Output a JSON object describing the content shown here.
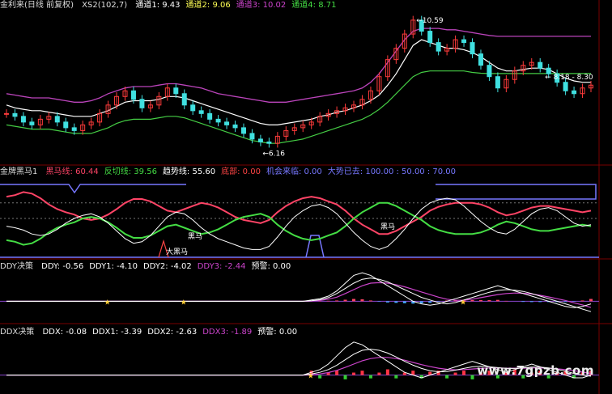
{
  "panels": {
    "main": {
      "title": "金利来(日线 前复权)",
      "params": "XS2(102,7)",
      "legend": [
        {
          "label": "通道1: 9.43",
          "color": "#ffffff"
        },
        {
          "label": "通道2: 9.06",
          "color": "#ffff55"
        },
        {
          "label": "通道3: 10.02",
          "color": "#cc44cc"
        },
        {
          "label": "通道4: 8.71",
          "color": "#44dd44"
        }
      ],
      "annotations": {
        "high": "10.59",
        "low": "6.16",
        "last": "8.18 - 8.30"
      }
    },
    "horse": {
      "title": "金牌黑马1",
      "legend": [
        {
          "label": "黑马线: 60.44",
          "color": "#ff4466"
        },
        {
          "label": "反切线: 39.56",
          "color": "#44dd44"
        },
        {
          "label": "趋势线: 55.60",
          "color": "#ffffff"
        },
        {
          "label": "底部: 0.00",
          "color": "#ff4444"
        },
        {
          "label": "机会来临: 0.00",
          "color": "#7777ff"
        },
        {
          "label": "大势已去: 100.00 : 50.00 : 70.00",
          "color": "#7777ff"
        }
      ],
      "annotations": {
        "dark_horse_1": "黑马",
        "dark_horse_2": "黑马",
        "big_horse": "大黑马"
      }
    },
    "ddy": {
      "title": "DDY决策",
      "legend": [
        {
          "label": "DDY: -0.56",
          "color": "#ffffff"
        },
        {
          "label": "DDY1: -4.10",
          "color": "#ffffff"
        },
        {
          "label": "DDY2: -4.02",
          "color": "#ffffff"
        },
        {
          "label": "DDY3: -2.44",
          "color": "#cc44cc"
        },
        {
          "label": "预警: 0.00",
          "color": "#ffffff"
        }
      ]
    },
    "ddx": {
      "title": "DDX决策",
      "legend": [
        {
          "label": "DDX: -0.08",
          "color": "#ffffff"
        },
        {
          "label": "DDX1: -3.39",
          "color": "#ffffff"
        },
        {
          "label": "DDX2: -2.63",
          "color": "#ffffff"
        },
        {
          "label": "DDX3: -1.89",
          "color": "#cc44cc"
        },
        {
          "label": "预警: 0.00",
          "color": "#ffffff"
        }
      ]
    }
  },
  "watermark": "www.7gpzb.com",
  "chart_data": {
    "type": "candlestick",
    "price_ylim": [
      5.6,
      10.9
    ],
    "prices": [
      7.3,
      7.2,
      7.0,
      6.9,
      7.1,
      7.2,
      7.0,
      6.8,
      6.7,
      6.9,
      7.0,
      7.3,
      7.6,
      7.9,
      8.1,
      7.8,
      7.5,
      7.6,
      7.9,
      8.2,
      8.0,
      7.6,
      7.4,
      7.3,
      7.1,
      7.0,
      6.9,
      6.8,
      6.6,
      6.4,
      6.3,
      6.25,
      6.5,
      6.7,
      6.8,
      6.9,
      7.0,
      7.2,
      7.3,
      7.4,
      7.5,
      7.6,
      7.8,
      8.1,
      8.6,
      9.2,
      9.6,
      10.1,
      10.59,
      10.2,
      9.8,
      9.5,
      9.6,
      9.9,
      9.8,
      9.4,
      9.0,
      8.6,
      8.2,
      8.5,
      8.8,
      9.0,
      9.1,
      8.9,
      8.7,
      8.4,
      8.1,
      8.0,
      8.2,
      8.3
    ],
    "channels": {
      "ch1": [
        7.6,
        7.5,
        7.45,
        7.4,
        7.4,
        7.35,
        7.3,
        7.25,
        7.2,
        7.2,
        7.2,
        7.3,
        7.4,
        7.55,
        7.7,
        7.75,
        7.75,
        7.75,
        7.8,
        7.9,
        7.9,
        7.85,
        7.75,
        7.65,
        7.55,
        7.45,
        7.35,
        7.25,
        7.15,
        7.05,
        6.95,
        6.9,
        6.9,
        6.95,
        7.0,
        7.05,
        7.1,
        7.2,
        7.25,
        7.35,
        7.4,
        7.5,
        7.6,
        7.75,
        7.95,
        8.3,
        8.7,
        9.2,
        9.7,
        9.9,
        9.8,
        9.7,
        9.6,
        9.6,
        9.55,
        9.45,
        9.3,
        9.1,
        8.9,
        8.8,
        8.8,
        8.85,
        8.9,
        8.9,
        8.85,
        8.7,
        8.55,
        8.45,
        8.4,
        8.4
      ],
      "ch3": [
        8.0,
        7.95,
        7.9,
        7.85,
        7.85,
        7.85,
        7.8,
        7.75,
        7.7,
        7.7,
        7.75,
        7.85,
        8.0,
        8.1,
        8.2,
        8.25,
        8.25,
        8.25,
        8.3,
        8.35,
        8.35,
        8.3,
        8.25,
        8.2,
        8.1,
        8.0,
        7.95,
        7.9,
        7.85,
        7.8,
        7.75,
        7.7,
        7.7,
        7.7,
        7.75,
        7.8,
        7.85,
        7.9,
        7.95,
        8.0,
        8.05,
        8.1,
        8.2,
        8.4,
        8.7,
        9.1,
        9.5,
        9.9,
        10.2,
        10.3,
        10.3,
        10.3,
        10.25,
        10.25,
        10.2,
        10.15,
        10.1,
        10.05,
        10.02,
        10.02,
        10.02,
        10.02,
        10.02,
        10.02,
        10.02,
        10.02,
        10.02,
        10.02,
        10.02,
        10.02
      ],
      "ch4": [
        6.9,
        6.85,
        6.8,
        6.75,
        6.75,
        6.75,
        6.7,
        6.65,
        6.6,
        6.6,
        6.6,
        6.7,
        6.8,
        6.95,
        7.05,
        7.1,
        7.1,
        7.1,
        7.15,
        7.2,
        7.2,
        7.15,
        7.05,
        6.95,
        6.85,
        6.75,
        6.65,
        6.55,
        6.45,
        6.35,
        6.3,
        6.25,
        6.25,
        6.3,
        6.35,
        6.4,
        6.5,
        6.6,
        6.7,
        6.8,
        6.9,
        7.0,
        7.1,
        7.25,
        7.45,
        7.7,
        8.0,
        8.3,
        8.6,
        8.75,
        8.8,
        8.8,
        8.8,
        8.8,
        8.8,
        8.75,
        8.72,
        8.71,
        8.71,
        8.71,
        8.71,
        8.71,
        8.71,
        8.71,
        8.71,
        8.71,
        8.71,
        8.71,
        8.71,
        8.71
      ]
    },
    "horse_ylim": [
      0,
      100
    ],
    "horse_red": [
      78,
      80,
      84,
      82,
      76,
      68,
      62,
      58,
      55,
      50,
      48,
      50,
      55,
      62,
      70,
      75,
      75,
      72,
      66,
      60,
      58,
      62,
      66,
      70,
      68,
      64,
      58,
      52,
      48,
      46,
      44,
      48,
      58,
      66,
      72,
      76,
      78,
      76,
      72,
      68,
      60,
      50,
      42,
      36,
      30,
      30,
      34,
      40,
      46,
      52,
      60,
      65,
      68,
      70,
      70,
      70,
      68,
      64,
      58,
      54,
      56,
      60,
      64,
      66,
      66,
      64,
      62,
      60,
      58,
      60
    ],
    "horse_green": [
      22,
      20,
      16,
      18,
      24,
      32,
      38,
      42,
      45,
      50,
      52,
      50,
      45,
      38,
      30,
      25,
      25,
      28,
      34,
      40,
      42,
      38,
      34,
      30,
      32,
      36,
      42,
      48,
      52,
      54,
      56,
      52,
      42,
      34,
      28,
      24,
      22,
      24,
      28,
      32,
      40,
      50,
      58,
      64,
      70,
      70,
      66,
      60,
      54,
      48,
      40,
      35,
      32,
      30,
      30,
      30,
      32,
      36,
      42,
      46,
      44,
      40,
      36,
      34,
      34,
      36,
      38,
      40,
      42,
      40
    ],
    "horse_white": [
      40,
      38,
      35,
      30,
      28,
      30,
      36,
      44,
      50,
      54,
      56,
      52,
      44,
      34,
      24,
      18,
      20,
      28,
      40,
      52,
      58,
      56,
      48,
      38,
      30,
      24,
      20,
      16,
      12,
      10,
      10,
      14,
      26,
      40,
      52,
      60,
      66,
      68,
      64,
      56,
      44,
      32,
      22,
      14,
      10,
      14,
      24,
      36,
      50,
      62,
      70,
      74,
      76,
      74,
      66,
      56,
      46,
      38,
      32,
      30,
      36,
      46,
      56,
      62,
      64,
      60,
      52,
      44,
      40,
      42
    ],
    "ddy_ylim": [
      -8,
      12
    ],
    "ddy_lines": {
      "a": [
        0,
        0,
        0,
        0,
        0,
        0,
        0,
        0,
        0,
        0,
        0,
        0,
        0,
        0,
        0,
        0,
        0,
        0,
        0,
        0,
        0,
        0,
        0,
        0,
        0,
        0,
        0,
        0,
        0,
        0,
        0,
        0,
        0,
        0,
        0,
        0,
        0.5,
        1,
        2,
        4,
        7,
        10,
        11,
        10,
        8,
        6,
        4,
        2,
        0,
        -1,
        -1.5,
        -1,
        0,
        1,
        2,
        3,
        4,
        5,
        6,
        5,
        4,
        3,
        2,
        1,
        0,
        -1,
        -2,
        -2.5,
        -2,
        -1
      ],
      "b": [
        0,
        0,
        0,
        0,
        0,
        0,
        0,
        0,
        0,
        0,
        0,
        0,
        0,
        0,
        0,
        0,
        0,
        0,
        0,
        0,
        0,
        0,
        0,
        0,
        0,
        0,
        0,
        0,
        0,
        0,
        0,
        0,
        0,
        0,
        0,
        0,
        0.2,
        0.6,
        1.4,
        3,
        5,
        7,
        8.5,
        9,
        8.5,
        7.5,
        6,
        4.5,
        3,
        1.5,
        0.5,
        -0.5,
        -1,
        -0.5,
        0.5,
        1.5,
        2.5,
        3.5,
        4.2,
        4.5,
        4.3,
        3.8,
        3,
        2,
        1,
        0,
        -1,
        -2,
        -3,
        -4
      ],
      "c": [
        0,
        0,
        0,
        0,
        0,
        0,
        0,
        0,
        0,
        0,
        0,
        0,
        0,
        0,
        0,
        0,
        0,
        0,
        0,
        0,
        0,
        0,
        0,
        0,
        0,
        0,
        0,
        0,
        0,
        0,
        0,
        0,
        0,
        0,
        0,
        0,
        0.1,
        0.3,
        0.8,
        1.6,
        3,
        4.5,
        6,
        7,
        7.2,
        7,
        6.4,
        5.6,
        4.6,
        3.6,
        2.6,
        1.6,
        0.8,
        0.4,
        0.4,
        0.8,
        1.4,
        2,
        2.6,
        3,
        3.2,
        3.1,
        2.8,
        2.3,
        1.7,
        1,
        0.3,
        -0.6,
        -1.4,
        -2.4
      ]
    },
    "ddx_ylim": [
      -6,
      14
    ],
    "ddx_lines": {
      "a": [
        0,
        0,
        0,
        0,
        0,
        0,
        0,
        0,
        0,
        0,
        0,
        0,
        0,
        0,
        0,
        0,
        0,
        0,
        0,
        0,
        0,
        0,
        0,
        0,
        0,
        0,
        0,
        0,
        0,
        0,
        0,
        0,
        0,
        0,
        0,
        0,
        1,
        2,
        4,
        7,
        10,
        12,
        11,
        9,
        7,
        5,
        3,
        1,
        0,
        -1,
        0,
        1,
        2,
        3,
        4,
        5,
        4,
        3,
        2,
        1,
        2,
        3,
        4,
        3,
        2,
        1,
        0,
        -1,
        -1,
        0
      ],
      "b": [
        0,
        0,
        0,
        0,
        0,
        0,
        0,
        0,
        0,
        0,
        0,
        0,
        0,
        0,
        0,
        0,
        0,
        0,
        0,
        0,
        0,
        0,
        0,
        0,
        0,
        0,
        0,
        0,
        0,
        0,
        0,
        0,
        0,
        0,
        0,
        0,
        0.4,
        1,
        2,
        3.6,
        5.6,
        7.6,
        9,
        9.4,
        9,
        8,
        6.6,
        5,
        3.6,
        2.4,
        1.6,
        1.2,
        1.3,
        1.8,
        2.4,
        3,
        3.2,
        3,
        2.7,
        2.4,
        2.4,
        2.6,
        2.9,
        2.9,
        2.6,
        2.1,
        1.4,
        0.6,
        0,
        -0.4
      ],
      "c": [
        0,
        0,
        0,
        0,
        0,
        0,
        0,
        0,
        0,
        0,
        0,
        0,
        0,
        0,
        0,
        0,
        0,
        0,
        0,
        0,
        0,
        0,
        0,
        0,
        0,
        0,
        0,
        0,
        0,
        0,
        0,
        0,
        0,
        0,
        0,
        0,
        0.1,
        0.4,
        0.9,
        1.7,
        2.8,
        4,
        5.2,
        6,
        6.4,
        6.4,
        6,
        5.4,
        4.6,
        3.8,
        3.1,
        2.5,
        2.1,
        1.9,
        2,
        2.2,
        2.4,
        2.6,
        2.6,
        2.5,
        2.5,
        2.5,
        2.6,
        2.6,
        2.5,
        2.3,
        2,
        1.6,
        1.1,
        0.6
      ]
    }
  }
}
